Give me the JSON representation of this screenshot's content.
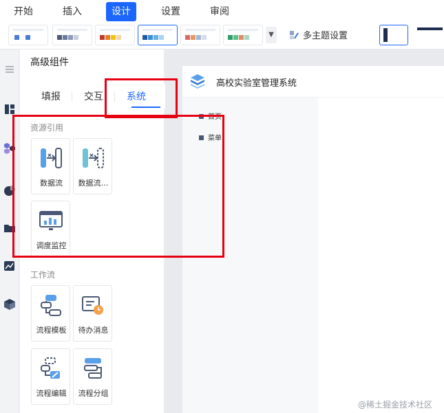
{
  "menubar": {
    "items": [
      {
        "label": "开始"
      },
      {
        "label": "插入"
      },
      {
        "label": "设计"
      },
      {
        "label": "设置"
      },
      {
        "label": "审阅"
      }
    ],
    "active": "设计"
  },
  "ribbon": {
    "multi_theme_label": "多主题设置"
  },
  "panel": {
    "title": "高级组件",
    "tabs": [
      {
        "label": "填报"
      },
      {
        "label": "交互"
      },
      {
        "label": "系统"
      }
    ],
    "active_tab": "系统",
    "sections": [
      {
        "title": "资源引用",
        "items": [
          {
            "label": "数据流",
            "icon": "data-flow-icon"
          },
          {
            "label": "数据流…",
            "icon": "data-flow-alt-icon"
          },
          {
            "label": "调度监控",
            "icon": "schedule-monitor-icon"
          }
        ]
      },
      {
        "title": "工作流",
        "items": [
          {
            "label": "流程模板",
            "icon": "flow-template-icon"
          },
          {
            "label": "待办消息",
            "icon": "todo-message-icon"
          },
          {
            "label": "流程编辑",
            "icon": "flow-edit-icon"
          },
          {
            "label": "流程分组",
            "icon": "flow-group-icon"
          }
        ]
      }
    ]
  },
  "preview": {
    "title": "高校实验室管理系统",
    "nav": [
      {
        "label": "首页"
      },
      {
        "label": "菜单"
      }
    ]
  },
  "watermark": "@稀土掘金技术社区",
  "colors": {
    "accent": "#1a66ff",
    "highlight_box": "#e60012"
  }
}
